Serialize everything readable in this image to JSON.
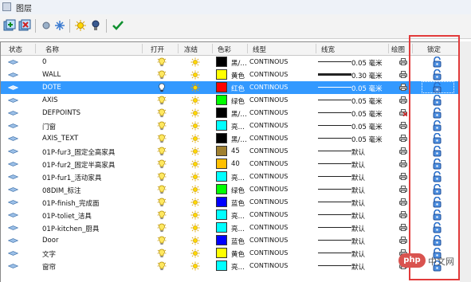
{
  "window": {
    "title": "图层"
  },
  "headers": {
    "status": "状态",
    "name": "名称",
    "on": "打开",
    "freeze": "冻结",
    "color": "色彩",
    "linetype": "线型",
    "lineweight": "线宽",
    "plot": "绘图",
    "lock": "锁定"
  },
  "layers": [
    {
      "name": "0",
      "color_name": "黑/…",
      "color_hex": "#000000",
      "linetype": "CONTINOUS",
      "lineweight": "0.05 毫米",
      "lw_style": "thin",
      "selected": false,
      "plot_icon": "printer-icon"
    },
    {
      "name": "WALL",
      "color_name": "黄色",
      "color_hex": "#ffff00",
      "linetype": "CONTINOUS",
      "lineweight": "0.30 毫米",
      "lw_style": "thick",
      "selected": false,
      "plot_icon": "printer-icon"
    },
    {
      "name": "DOTE",
      "color_name": "红色",
      "color_hex": "#ff0000",
      "linetype": "CONTINOUS",
      "lineweight": "0.05 毫米",
      "lw_style": "thin",
      "selected": true,
      "plot_icon": "printer-icon"
    },
    {
      "name": "AXIS",
      "color_name": "绿色",
      "color_hex": "#00ff00",
      "linetype": "CONTINOUS",
      "lineweight": "0.05 毫米",
      "lw_style": "thin",
      "selected": false,
      "plot_icon": "printer-icon"
    },
    {
      "name": "DEFPOINTS",
      "color_name": "黑/…",
      "color_hex": "#000000",
      "linetype": "CONTINOUS",
      "lineweight": "0.05 毫米",
      "lw_style": "thin",
      "selected": false,
      "plot_icon": "printer-disabled-icon"
    },
    {
      "name": "门窗",
      "color_name": "亮…",
      "color_hex": "#00ffff",
      "linetype": "CONTINOUS",
      "lineweight": "0.05 毫米",
      "lw_style": "thin",
      "selected": false,
      "plot_icon": "printer-icon"
    },
    {
      "name": "AXIS_TEXT",
      "color_name": "黑/…",
      "color_hex": "#000000",
      "linetype": "CONTINOUS",
      "lineweight": "0.05 毫米",
      "lw_style": "thin",
      "selected": false,
      "plot_icon": "printer-icon"
    },
    {
      "name": "01P-fur3_固定全高家具",
      "color_name": "45",
      "color_hex": "#a08030",
      "linetype": "CONTINOUS",
      "lineweight": "默认",
      "lw_style": "thin",
      "selected": false,
      "plot_icon": "printer-icon"
    },
    {
      "name": "01P-fur2_固定半高家具",
      "color_name": "40",
      "color_hex": "#ffc000",
      "linetype": "CONTINOUS",
      "lineweight": "默认",
      "lw_style": "thin",
      "selected": false,
      "plot_icon": "printer-icon"
    },
    {
      "name": "01P-fur1_活动家具",
      "color_name": "亮…",
      "color_hex": "#00ffff",
      "linetype": "CONTINOUS",
      "lineweight": "默认",
      "lw_style": "thin",
      "selected": false,
      "plot_icon": "printer-icon"
    },
    {
      "name": "08DIM_标注",
      "color_name": "绿色",
      "color_hex": "#00ff00",
      "linetype": "CONTINOUS",
      "lineweight": "默认",
      "lw_style": "thin",
      "selected": false,
      "plot_icon": "printer-icon"
    },
    {
      "name": "01P-finish_完成面",
      "color_name": "蓝色",
      "color_hex": "#0000ff",
      "linetype": "CONTINOUS",
      "lineweight": "默认",
      "lw_style": "thin",
      "selected": false,
      "plot_icon": "printer-icon"
    },
    {
      "name": "01P-toliet_洁具",
      "color_name": "亮…",
      "color_hex": "#00ffff",
      "linetype": "CONTINOUS",
      "lineweight": "默认",
      "lw_style": "thin",
      "selected": false,
      "plot_icon": "printer-icon"
    },
    {
      "name": "01P-kitchen_厨具",
      "color_name": "亮…",
      "color_hex": "#00ffff",
      "linetype": "CONTINOUS",
      "lineweight": "默认",
      "lw_style": "thin",
      "selected": false,
      "plot_icon": "printer-icon"
    },
    {
      "name": "Door",
      "color_name": "蓝色",
      "color_hex": "#0000ff",
      "linetype": "CONTINOUS",
      "lineweight": "默认",
      "lw_style": "thin",
      "selected": false,
      "plot_icon": "printer-icon"
    },
    {
      "name": "文字",
      "color_name": "黄色",
      "color_hex": "#ffff00",
      "linetype": "CONTINOUS",
      "lineweight": "默认",
      "lw_style": "thin",
      "selected": false,
      "plot_icon": "printer-icon"
    },
    {
      "name": "窗帘",
      "color_name": "亮…",
      "color_hex": "#00ffff",
      "linetype": "CONTINOUS",
      "lineweight": "默认",
      "lw_style": "thin",
      "selected": false,
      "plot_icon": "printer-icon"
    }
  ],
  "toolbar": {
    "icons": [
      "new-layer-icon",
      "delete-layer-icon",
      "freeze-all-icon",
      "thaw-all-icon",
      "lightbulb-sun-icon",
      "lightbulb-off-icon",
      "apply-check-icon"
    ]
  },
  "watermark": {
    "badge": "php",
    "text": "中文网"
  },
  "colors": {
    "selection": "#3399ff",
    "highlight_box": "#e23a3a",
    "lock_blue": "#2a6fc9"
  }
}
